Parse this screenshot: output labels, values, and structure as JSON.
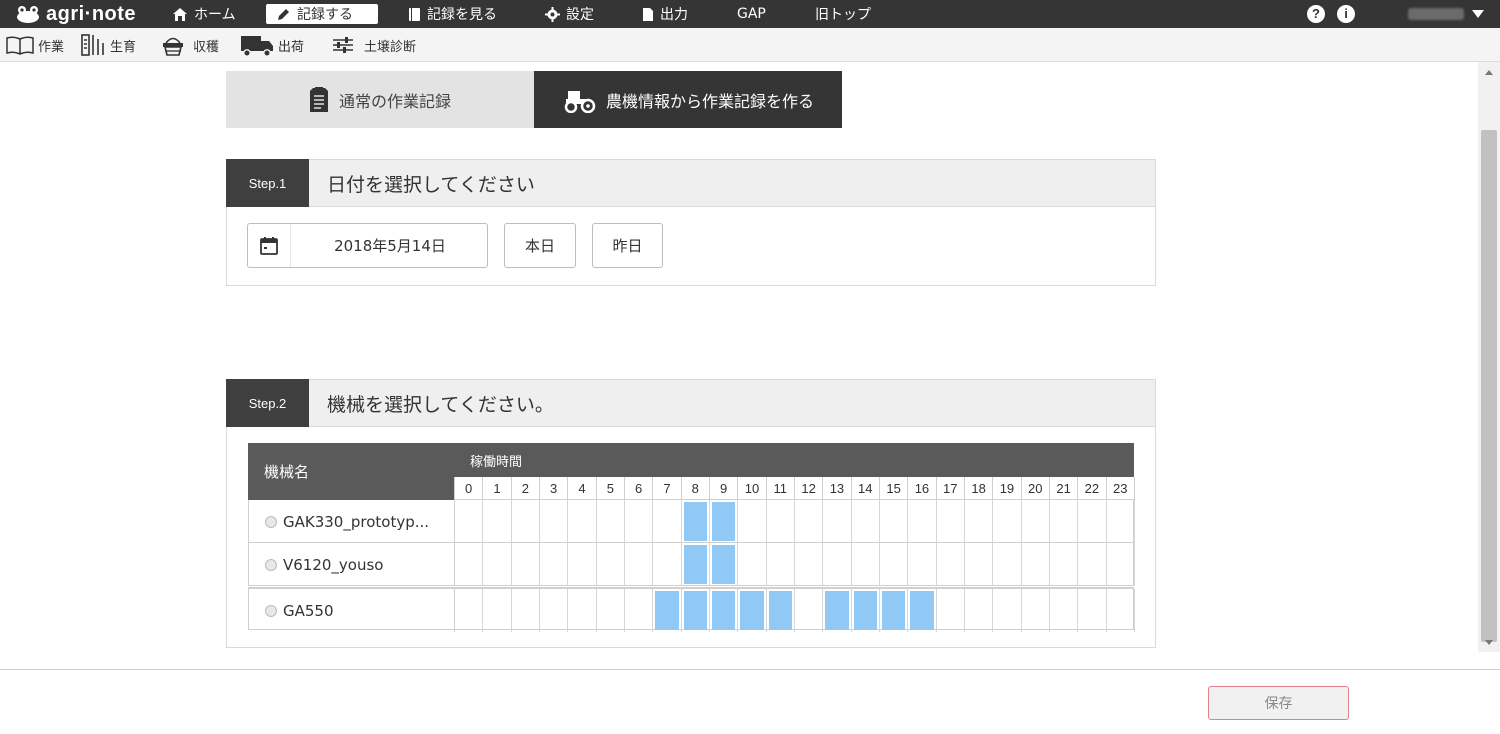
{
  "app": {
    "logo_text": "agri·note"
  },
  "topnav": {
    "items": [
      {
        "label": "ホーム",
        "icon": "home-icon"
      },
      {
        "label": "記録する",
        "icon": "pencil-icon",
        "active": true
      },
      {
        "label": "記録を見る",
        "icon": "book-icon"
      },
      {
        "label": "設定",
        "icon": "gear-icon"
      },
      {
        "label": "出力",
        "icon": "file-icon"
      },
      {
        "label": "GAP"
      },
      {
        "label": "旧トップ"
      }
    ],
    "help_glyph": "?",
    "info_glyph": "i"
  },
  "subnav": {
    "items": [
      {
        "label": "作業",
        "icon": "open-book-icon"
      },
      {
        "label": "生育",
        "icon": "growth-icon"
      },
      {
        "label": "収穫",
        "icon": "basket-icon"
      },
      {
        "label": "出荷",
        "icon": "truck-icon"
      },
      {
        "label": "土壌診断",
        "icon": "sliders-icon"
      }
    ]
  },
  "record_tabs": {
    "normal": "通常の作業記録",
    "machine": "農機情報から作業記録を作る"
  },
  "step1": {
    "badge": "Step.1",
    "title": "日付を選択してください",
    "date_value": "2018年5月14日",
    "today_label": "本日",
    "yesterday_label": "昨日"
  },
  "step2": {
    "badge": "Step.2",
    "title": "機械を選択してください。",
    "col_machine": "機械名",
    "col_hours": "稼働時間",
    "hours": [
      "0",
      "1",
      "2",
      "3",
      "4",
      "5",
      "6",
      "7",
      "8",
      "9",
      "10",
      "11",
      "12",
      "13",
      "14",
      "15",
      "16",
      "17",
      "18",
      "19",
      "20",
      "21",
      "22",
      "23"
    ],
    "machines": [
      {
        "name": "GAK330_prototyp...",
        "active_hours": [
          8,
          9
        ]
      },
      {
        "name": "V6120_youso",
        "active_hours": [
          8,
          9
        ]
      },
      {
        "name": "GA550",
        "active_hours": [
          7,
          8,
          9,
          10,
          11,
          13,
          14,
          15,
          16
        ]
      }
    ]
  },
  "footer": {
    "save_label": "保存"
  },
  "colors": {
    "dark": "#353535",
    "active_slot": "#90c8f6",
    "save_border": "#e0828a"
  }
}
